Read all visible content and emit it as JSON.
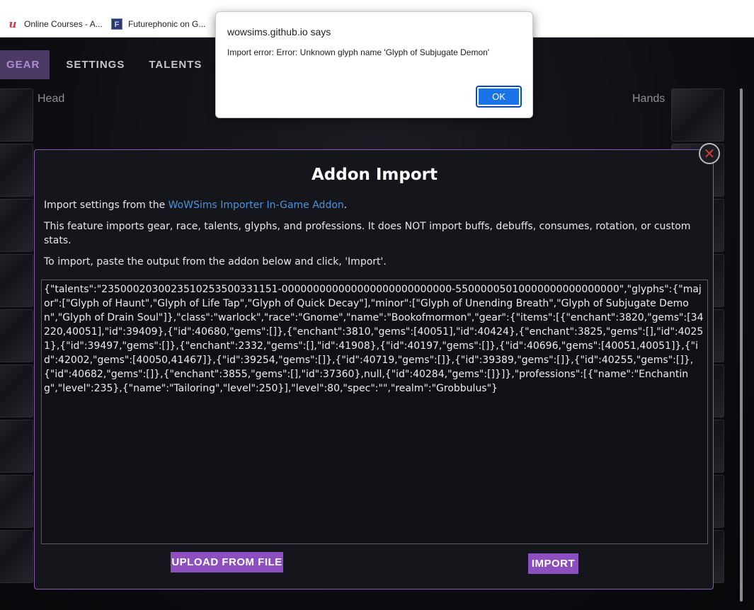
{
  "bookmarks": [
    {
      "label": "Online Courses - A...",
      "icon": "udemy-icon"
    },
    {
      "label": "Futurephonic on G...",
      "icon": "futurephonic-icon"
    }
  ],
  "tabs": {
    "gear": "GEAR",
    "settings": "SETTINGS",
    "talents": "TALENTS"
  },
  "slots": {
    "head_label": "Head",
    "hands_label": "Hands"
  },
  "modal": {
    "title": "Addon Import",
    "intro_prefix": "Import settings from the ",
    "intro_link": "WoWSims Importer In-Game Addon",
    "intro_suffix": ".",
    "feature_note": "This feature imports gear, race, talents, glyphs, and professions. It does NOT import buffs, debuffs, consumes, rotation, or custom stats.",
    "instructions": "To import, paste the output from the addon below and click, 'Import'.",
    "textarea_value": "{\"talents\":\"2350002030023510253500331151-000000000000000000000000000-55000005010000000000000000\",\"glyphs\":{\"major\":[\"Glyph of Haunt\",\"Glyph of Life Tap\",\"Glyph of Quick Decay\"],\"minor\":[\"Glyph of Unending Breath\",\"Glyph of Subjugate Demon\",\"Glyph of Drain Soul\"]},\"class\":\"warlock\",\"race\":\"Gnome\",\"name\":\"Bookofmormon\",\"gear\":{\"items\":[{\"enchant\":3820,\"gems\":[34220,40051],\"id\":39409},{\"id\":40680,\"gems\":[]},{\"enchant\":3810,\"gems\":[40051],\"id\":40424},{\"enchant\":3825,\"gems\":[],\"id\":40251},{\"id\":39497,\"gems\":[]},{\"enchant\":2332,\"gems\":[],\"id\":41908},{\"id\":40197,\"gems\":[]},{\"id\":40696,\"gems\":[40051,40051]},{\"id\":42002,\"gems\":[40050,41467]},{\"id\":39254,\"gems\":[]},{\"id\":40719,\"gems\":[]},{\"id\":39389,\"gems\":[]},{\"id\":40255,\"gems\":[]},{\"id\":40682,\"gems\":[]},{\"enchant\":3855,\"gems\":[],\"id\":37360},null,{\"id\":40284,\"gems\":[]}]},\"professions\":[{\"name\":\"Enchanting\",\"level\":235},{\"name\":\"Tailoring\",\"level\":250}],\"level\":80,\"spec\":\"\",\"realm\":\"Grobbulus\"}",
    "upload_label": "UPLOAD FROM FILE",
    "import_label": "IMPORT",
    "close_glyph": "✕"
  },
  "dialog": {
    "title": "wowsims.github.io says",
    "message": "Import error: Error: Unknown glyph name 'Glyph of Subjugate Demon'",
    "ok_label": "OK"
  },
  "colors": {
    "accent": "#8d4fc0",
    "modal_border": "#8c57b5",
    "link": "#4d93d9",
    "dialog_ok": "#1a73e8"
  }
}
